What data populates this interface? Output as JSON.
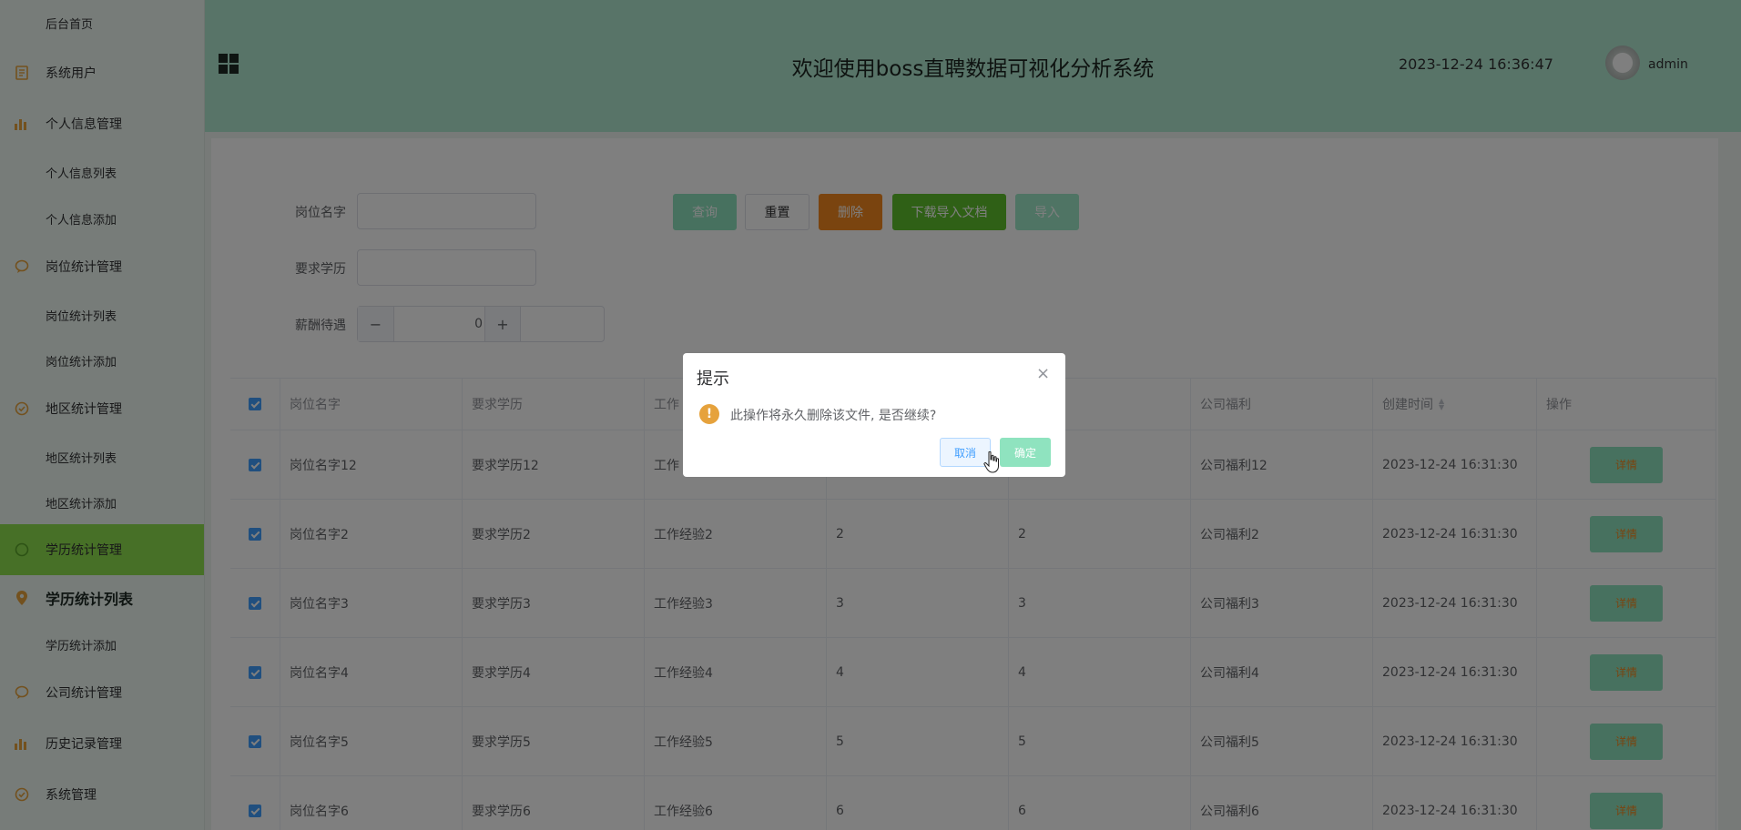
{
  "sidebar": {
    "items": [
      {
        "label": "后台首页",
        "icon": "none",
        "type": "sub"
      },
      {
        "label": "系统用户",
        "icon": "document-icon",
        "type": "main"
      },
      {
        "label": "个人信息管理",
        "icon": "bar-chart-icon",
        "type": "main"
      },
      {
        "label": "个人信息列表",
        "icon": "none",
        "type": "sub"
      },
      {
        "label": "个人信息添加",
        "icon": "none",
        "type": "sub"
      },
      {
        "label": "岗位统计管理",
        "icon": "chat-icon",
        "type": "main"
      },
      {
        "label": "岗位统计列表",
        "icon": "none",
        "type": "sub"
      },
      {
        "label": "岗位统计添加",
        "icon": "none",
        "type": "sub"
      },
      {
        "label": "地区统计管理",
        "icon": "check-circle-icon",
        "type": "main"
      },
      {
        "label": "地区统计列表",
        "icon": "none",
        "type": "sub"
      },
      {
        "label": "地区统计添加",
        "icon": "none",
        "type": "sub"
      },
      {
        "label": "学历统计管理",
        "icon": "grid-icon",
        "type": "main-active"
      },
      {
        "label": "学历统计列表",
        "icon": "location-icon",
        "type": "current"
      },
      {
        "label": "学历统计添加",
        "icon": "none",
        "type": "sub"
      },
      {
        "label": "公司统计管理",
        "icon": "chat-icon",
        "type": "main"
      },
      {
        "label": "历史记录管理",
        "icon": "bar-chart-icon",
        "type": "main"
      },
      {
        "label": "系统管理",
        "icon": "check-circle-icon",
        "type": "main"
      }
    ]
  },
  "header": {
    "title": "欢迎使用boss直聘数据可视化分析系统",
    "datetime": "2023-12-24 16:36:47",
    "username": "admin"
  },
  "search": {
    "job_name_label": "岗位名字",
    "job_name_value": "",
    "education_label": "要求学历",
    "education_value": "",
    "salary_label": "薪酬待遇",
    "salary_value": "0",
    "stepper_minus": "−",
    "stepper_plus": "+"
  },
  "toolbar": {
    "query": "查询",
    "reset": "重置",
    "delete": "删除",
    "download": "下载导入文档",
    "import": "导入"
  },
  "table": {
    "headers": {
      "job_name": "岗位名字",
      "education": "要求学历",
      "experience": "工作",
      "salary": "",
      "col5": "",
      "welfare": "公司福利",
      "created": "创建时间",
      "actions": "操作"
    },
    "detail_label": "详情",
    "rows": [
      {
        "job_name": "岗位名字12",
        "education": "要求学历12",
        "experience": "工作",
        "salary": "",
        "col5": "",
        "welfare": "公司福利12",
        "created": "2023-12-24 16:31:30"
      },
      {
        "job_name": "岗位名字2",
        "education": "要求学历2",
        "experience": "工作经验2",
        "salary": "2",
        "col5": "2",
        "welfare": "公司福利2",
        "created": "2023-12-24 16:31:30"
      },
      {
        "job_name": "岗位名字3",
        "education": "要求学历3",
        "experience": "工作经验3",
        "salary": "3",
        "col5": "3",
        "welfare": "公司福利3",
        "created": "2023-12-24 16:31:30"
      },
      {
        "job_name": "岗位名字4",
        "education": "要求学历4",
        "experience": "工作经验4",
        "salary": "4",
        "col5": "4",
        "welfare": "公司福利4",
        "created": "2023-12-24 16:31:30"
      },
      {
        "job_name": "岗位名字5",
        "education": "要求学历5",
        "experience": "工作经验5",
        "salary": "5",
        "col5": "5",
        "welfare": "公司福利5",
        "created": "2023-12-24 16:31:30"
      },
      {
        "job_name": "岗位名字6",
        "education": "要求学历6",
        "experience": "工作经验6",
        "salary": "6",
        "col5": "6",
        "welfare": "公司福利6",
        "created": "2023-12-24 16:31:30"
      }
    ]
  },
  "dialog": {
    "title": "提示",
    "close": "×",
    "message": "此操作将永久删除该文件, 是否继续?",
    "warn_glyph": "!",
    "cancel": "取消",
    "confirm": "确定"
  },
  "colors": {
    "sidebar_bg": "#eef9f3",
    "header_bg": "#b0e8d0",
    "active_menu": "#8fe04e",
    "query_btn": "#8fe3bf",
    "delete_btn": "#f5891f",
    "download_btn": "#5ec02c",
    "checkbox": "#409eff",
    "warning": "#e6a23c"
  }
}
